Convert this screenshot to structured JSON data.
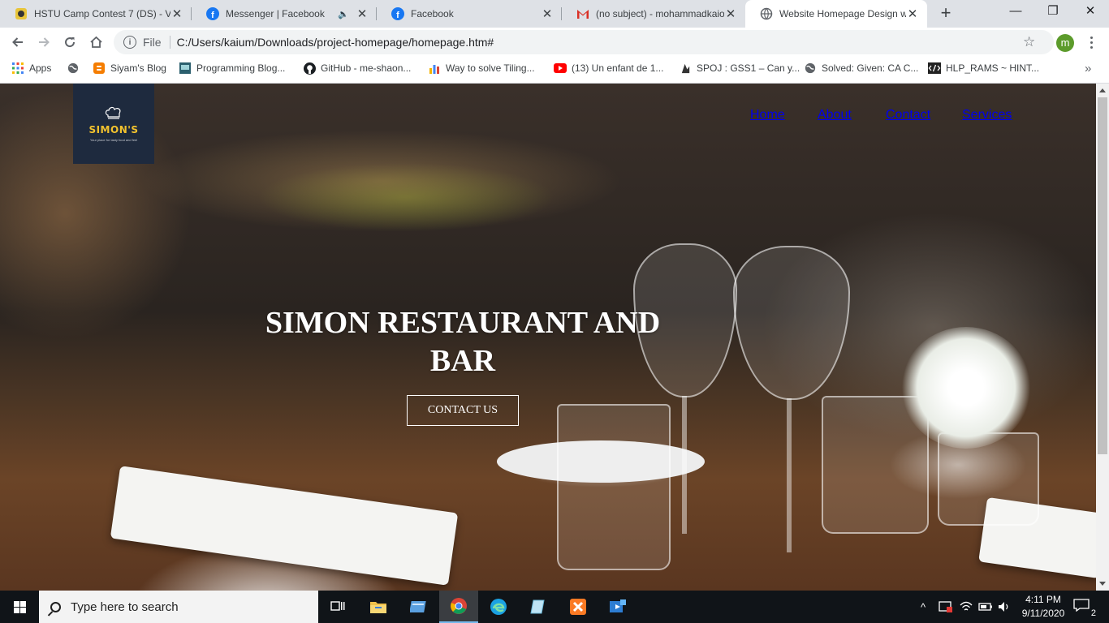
{
  "browser": {
    "tabs": [
      {
        "title": "HSTU Camp Contest 7 (DS) - V",
        "icon": "vjudge-icon",
        "muted": false,
        "active": false
      },
      {
        "title": "Messenger | Facebook",
        "icon": "facebook-icon",
        "muted": true,
        "active": false
      },
      {
        "title": "Facebook",
        "icon": "facebook-icon",
        "muted": false,
        "active": false
      },
      {
        "title": "(no subject) - mohammadkaiom",
        "icon": "gmail-icon",
        "muted": false,
        "active": false
      },
      {
        "title": "Website Homepage Design with",
        "icon": "globe-icon",
        "muted": false,
        "active": true
      }
    ],
    "address": {
      "scheme_label": "File",
      "url": "C:/Users/kaium/Downloads/project-homepage/homepage.htm#"
    },
    "profile_initial": "m",
    "bookmarks": [
      {
        "label": "Apps",
        "icon": "apps-grid-icon"
      },
      {
        "label": "",
        "icon": "globe-icon"
      },
      {
        "label": "Siyam's Blog",
        "icon": "blogger-icon"
      },
      {
        "label": "Programming Blog...",
        "icon": "site-icon"
      },
      {
        "label": "GitHub - me-shaon...",
        "icon": "github-icon"
      },
      {
        "label": "Way to solve Tiling...",
        "icon": "bar-chart-icon"
      },
      {
        "label": "(13) Un enfant de 1...",
        "icon": "youtube-icon"
      },
      {
        "label": "SPOJ : GSS1 – Can y...",
        "icon": "spoj-icon"
      },
      {
        "label": "Solved: Given: CA C...",
        "icon": "globe-icon"
      },
      {
        "label": "HLP_RAMS ~ HINT...",
        "icon": "code-icon"
      }
    ]
  },
  "page": {
    "logo": {
      "name": "SIMON'S",
      "tagline": "Your place for tasty food and feel"
    },
    "nav": [
      "Home",
      "About",
      "Contact",
      "Services"
    ],
    "headline": "SIMON RESTAURANT AND BAR",
    "cta": "CONTACT US"
  },
  "taskbar": {
    "search_placeholder": "Type here to search",
    "apps": [
      "task-view-icon",
      "file-explorer-icon",
      "app-window-icon",
      "chrome-icon",
      "edge-icon",
      "notepad-icon",
      "xampp-icon",
      "media-player-icon"
    ],
    "time": "4:11 PM",
    "date": "9/11/2020",
    "notifications": "2"
  },
  "colors": {
    "tabstrip": "#dee1e6",
    "logo_bg": "#1e2a3e",
    "logo_text": "#f2c22e",
    "taskbar": "#101418"
  }
}
